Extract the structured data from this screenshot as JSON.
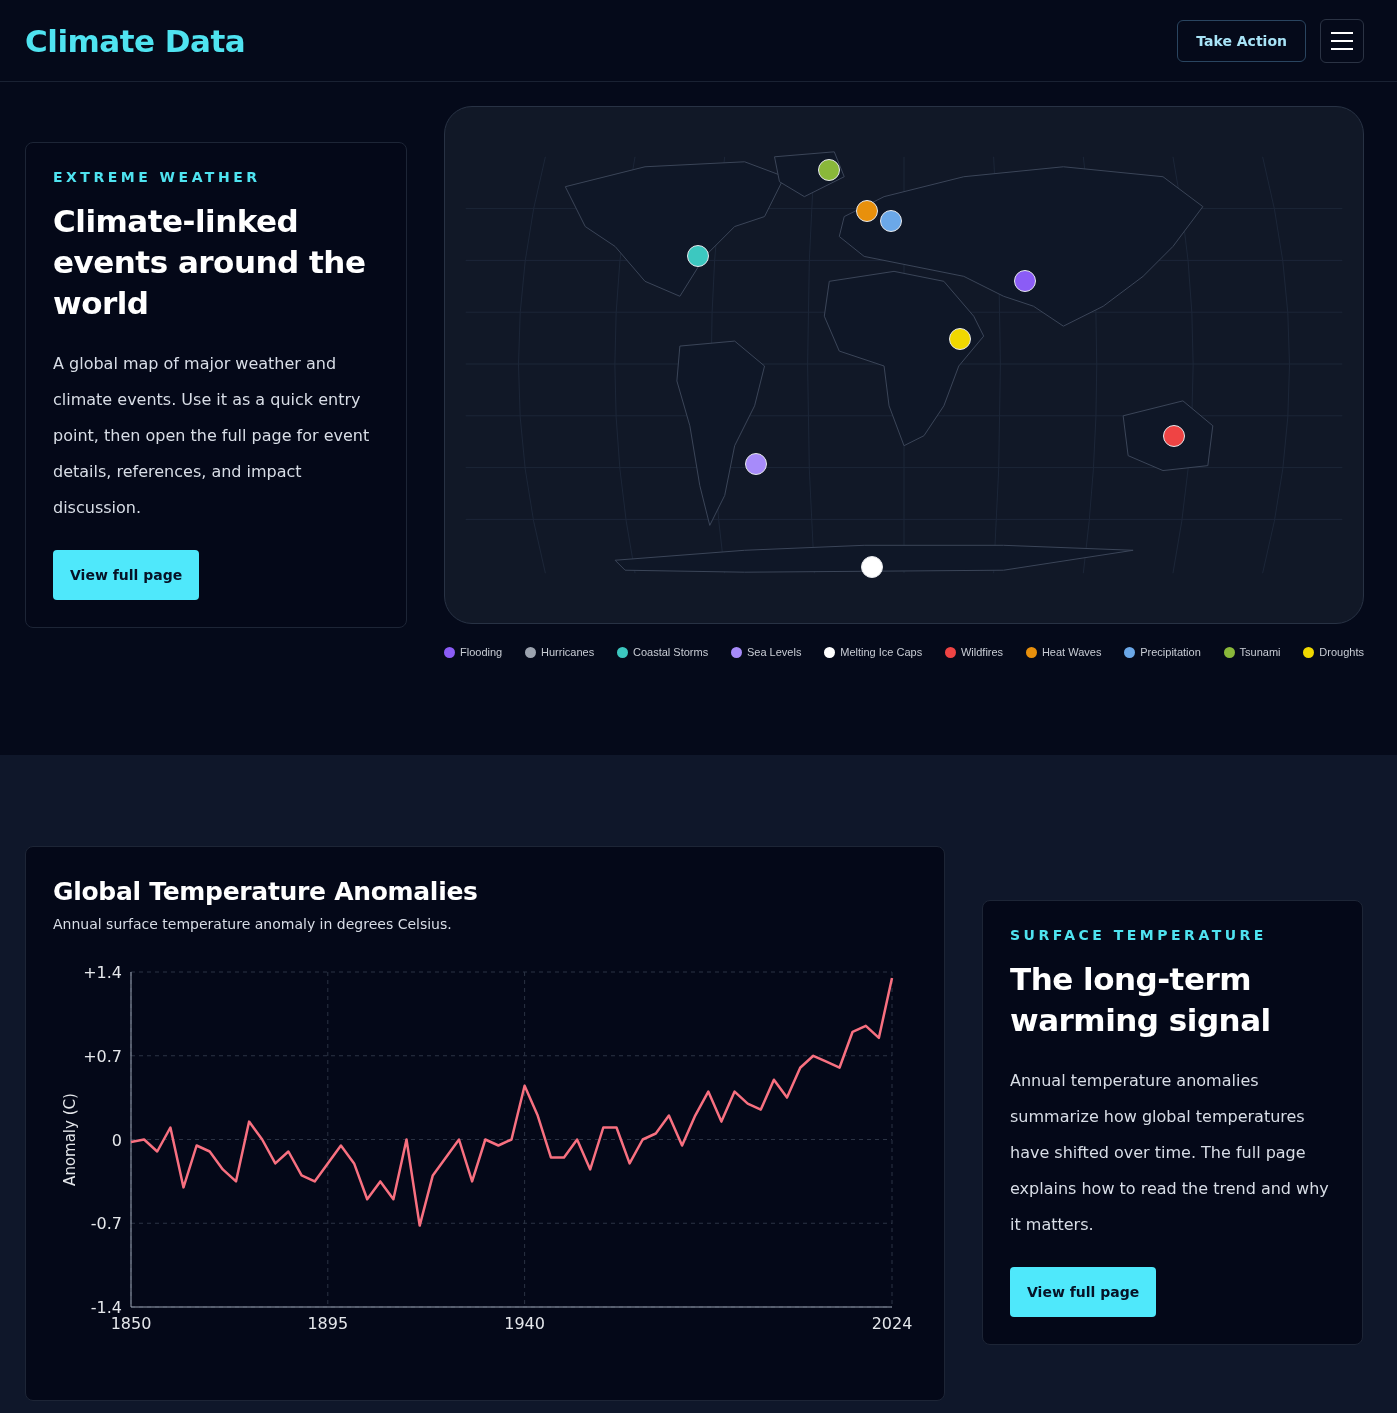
{
  "header": {
    "logo": "Climate Data",
    "action_button": "Take Action"
  },
  "events_card": {
    "eyebrow": "EXTREME WEATHER",
    "title": "Climate-linked events around the world",
    "body": "A global map of major weather and climate events. Use it as a quick entry point, then open the full page for event details, references, and impact discussion.",
    "button": "View full page"
  },
  "map": {
    "markers": [
      {
        "color": "#8ab83a"
      },
      {
        "color": "#e8900c"
      },
      {
        "color": "#6ba8e8"
      },
      {
        "color": "#3cc8c0"
      },
      {
        "color": "#8b5cf6"
      },
      {
        "color": "#f0d800"
      },
      {
        "color": "#ef4444"
      },
      {
        "color": "#a78bfa"
      },
      {
        "color": "#ffffff"
      }
    ]
  },
  "legend": [
    {
      "label": "Flooding",
      "color": "#8b5cf6"
    },
    {
      "label": "Hurricanes",
      "color": "#9ca3af"
    },
    {
      "label": "Coastal Storms",
      "color": "#3cc8c0"
    },
    {
      "label": "Sea Levels",
      "color": "#a78bfa"
    },
    {
      "label": "Melting Ice Caps",
      "color": "#ffffff"
    },
    {
      "label": "Wildfires",
      "color": "#ef4444"
    },
    {
      "label": "Heat Waves",
      "color": "#e8900c"
    },
    {
      "label": "Precipitation",
      "color": "#6ba8e8"
    },
    {
      "label": "Tsunami",
      "color": "#8ab83a"
    },
    {
      "label": "Droughts",
      "color": "#f0d800"
    }
  ],
  "chart_card": {
    "subtitle": "Annual surface temperature anomaly in degrees Celsius.",
    "chart_data": {
      "type": "line",
      "title": "Global Temperature Anomalies",
      "ylabel": "Anomaly (C)",
      "x": [
        1850,
        1853,
        1856,
        1859,
        1862,
        1865,
        1868,
        1871,
        1874,
        1877,
        1880,
        1883,
        1886,
        1889,
        1892,
        1895,
        1898,
        1901,
        1904,
        1907,
        1910,
        1913,
        1916,
        1919,
        1922,
        1925,
        1928,
        1931,
        1934,
        1937,
        1940,
        1943,
        1946,
        1949,
        1952,
        1955,
        1958,
        1961,
        1964,
        1967,
        1970,
        1973,
        1976,
        1979,
        1982,
        1985,
        1988,
        1991,
        1994,
        1997,
        2000,
        2003,
        2006,
        2009,
        2012,
        2015,
        2018,
        2021,
        2024
      ],
      "grid": true,
      "series": [
        {
          "color": "#f87080",
          "values": [
            -0.02,
            0.0,
            -0.1,
            0.1,
            -0.4,
            -0.05,
            -0.1,
            -0.25,
            -0.35,
            0.15,
            0.0,
            -0.2,
            -0.1,
            -0.3,
            -0.35,
            -0.2,
            -0.05,
            -0.2,
            -0.5,
            -0.35,
            -0.5,
            0.0,
            -0.72,
            -0.3,
            -0.15,
            0.0,
            -0.35,
            0.0,
            -0.05,
            0.0,
            0.45,
            0.2,
            -0.15,
            -0.15,
            0.0,
            -0.25,
            0.1,
            0.1,
            -0.2,
            0.0,
            0.05,
            0.2,
            -0.05,
            0.2,
            0.4,
            0.15,
            0.4,
            0.3,
            0.25,
            0.5,
            0.35,
            0.6,
            0.7,
            0.65,
            0.6,
            0.9,
            0.95,
            0.85,
            1.35
          ]
        }
      ],
      "xlim": [
        1850,
        2024
      ],
      "ylim": [
        -1.4,
        1.4
      ],
      "xticks": [
        1850,
        1895,
        1940,
        2024
      ],
      "yticks": [
        {
          "value": -1.4,
          "label": "-1.4"
        },
        {
          "value": -0.7,
          "label": "-0.7"
        },
        {
          "value": 0,
          "label": "0"
        },
        {
          "value": 0.7,
          "label": "+0.7"
        },
        {
          "value": 1.4,
          "label": "+1.4"
        }
      ]
    }
  },
  "signal_card": {
    "eyebrow": "SURFACE TEMPERATURE",
    "title": "The long-term warming signal",
    "body": "Annual temperature anomalies summarize how global temperatures have shifted over time. The full page explains how to read the trend and why it matters.",
    "button": "View full page"
  }
}
